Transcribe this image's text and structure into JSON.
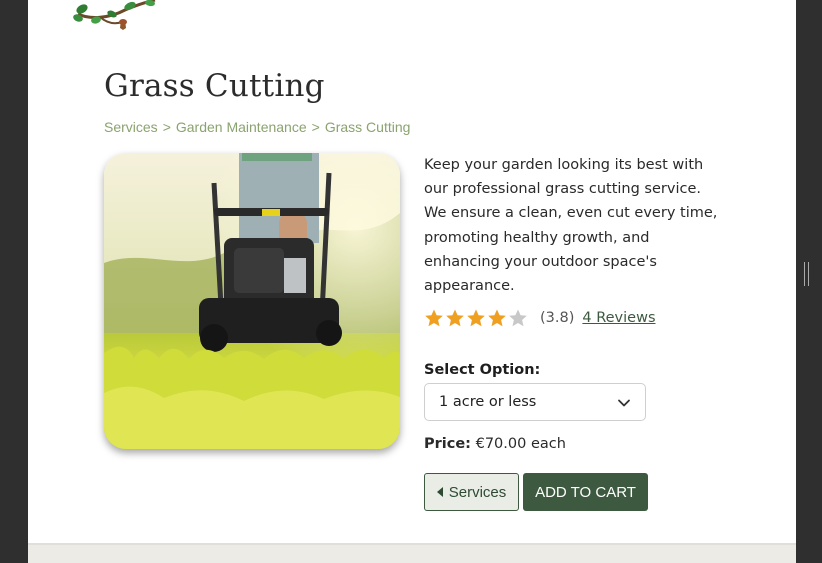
{
  "page": {
    "title": "Grass Cutting",
    "breadcrumb": [
      {
        "label": "Services"
      },
      {
        "label": "Garden Maintenance"
      },
      {
        "label": "Grass Cutting"
      }
    ],
    "breadcrumb_separator": ">"
  },
  "product": {
    "image_icon": "lawn-mower-photo",
    "description": "Keep your garden looking its best with our professional grass cutting service. We ensure a clean, even cut every time, promoting healthy growth, and enhancing your outdoor space's appearance.",
    "rating": {
      "value": 3.8,
      "display": "(3.8)",
      "max": 5,
      "reviews_label": "4 Reviews"
    },
    "option": {
      "label": "Select Option:",
      "selected": "1 acre or less"
    },
    "price": {
      "label": "Price:",
      "value": "€70.00 each"
    }
  },
  "buttons": {
    "services": "Services",
    "add_to_cart": "ADD TO CART"
  },
  "colors": {
    "accent": "#3d5a40",
    "breadcrumb": "#8aa36f",
    "star": "#f0a020",
    "star_empty": "#c8c8c8"
  }
}
